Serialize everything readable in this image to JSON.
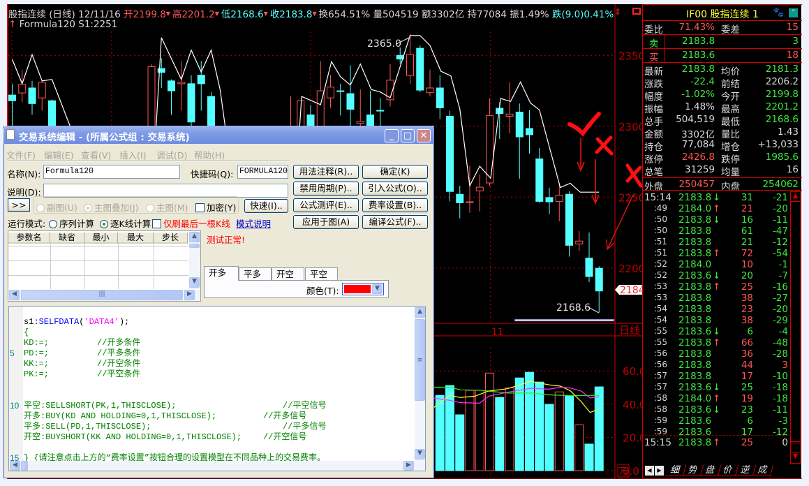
{
  "header": {
    "line1": [
      {
        "t": "股指连续 (日线) 12/11/16 ",
        "c": "w"
      },
      {
        "t": "开2199.8",
        "c": "r",
        "arrow": true
      },
      {
        "t": "高2201.2",
        "c": "r",
        "arrow": true
      },
      {
        "t": "低2168.6",
        "c": "c",
        "arrow": true
      },
      {
        "t": "收2183.8",
        "c": "c",
        "arrow": true
      },
      {
        "t": "换654.51% 量504519 额3302亿 持77084 振1.49% ",
        "c": "w"
      },
      {
        "t": "跌(9.0)0.41%",
        "c": "c"
      }
    ],
    "formula_arrow": "↑",
    "formula": "Formula120 S1:2251"
  },
  "chart_data": {
    "type": "candlestick",
    "price_axis": {
      "ticks": [
        "2350",
        "2300",
        "2250",
        "2200"
      ],
      "values": [
        2350,
        2300,
        2250,
        2200
      ]
    },
    "candles_note": "[bar_index, open, high, low, close]",
    "candles": [
      [
        0,
        2322,
        2330,
        2295,
        2318
      ],
      [
        1,
        2323.5,
        2340,
        2317,
        2329.6
      ],
      [
        2,
        2327,
        2332,
        2308,
        2316
      ],
      [
        3,
        2320,
        2332,
        2311,
        2331
      ],
      [
        4,
        2318,
        2319,
        2285,
        2290
      ],
      [
        14,
        2280,
        2344,
        2275,
        2342
      ],
      [
        15,
        2340.7,
        2348,
        2327,
        2338
      ],
      [
        16,
        2332,
        2333,
        2308,
        2325
      ],
      [
        17,
        2330,
        2346,
        2311,
        2331
      ],
      [
        18,
        2330,
        2336,
        2295,
        2303
      ],
      [
        19,
        2336,
        2346,
        2311,
        2330
      ],
      [
        20,
        2321,
        2324,
        2285,
        2290
      ],
      [
        28,
        2290,
        2321,
        2285,
        2292
      ],
      [
        29,
        2295,
        2318,
        2290,
        2318
      ],
      [
        30,
        2308,
        2315,
        2290,
        2295
      ],
      [
        31,
        2295,
        2346,
        2290,
        2325
      ],
      [
        32,
        2320,
        2336,
        2313,
        2327.6
      ],
      [
        33,
        2325,
        2330,
        2307.6,
        2324.5
      ],
      [
        34,
        2323,
        2343,
        2300,
        2312
      ],
      [
        35,
        2302,
        2326,
        2295,
        2303.5
      ],
      [
        36,
        2308,
        2325,
        2290,
        2295
      ],
      [
        37,
        2311.2,
        2320,
        2298,
        2311
      ],
      [
        38,
        2318.7,
        2344,
        2314,
        2332.5
      ],
      [
        39,
        2350,
        2355.6,
        2344,
        2347.4
      ],
      [
        40,
        2335.8,
        2365,
        2330,
        2350.7
      ],
      [
        41,
        2355,
        2357,
        2324,
        2325.5
      ],
      [
        42,
        2323.7,
        2340,
        2321,
        2327
      ],
      [
        43,
        2327,
        2336,
        2305,
        2313
      ],
      [
        44,
        2307,
        2311,
        2247,
        2254
      ],
      [
        45,
        2252,
        2258,
        2235,
        2246
      ],
      [
        46,
        2246.3,
        2272,
        2239,
        2246.7
      ],
      [
        47,
        2254.4,
        2266,
        2240,
        2257
      ],
      [
        48,
        2260,
        2319.6,
        2257.7,
        2307.6
      ],
      [
        49,
        2312.7,
        2317,
        2291,
        2309
      ],
      [
        50,
        2307,
        2331,
        2295,
        2308.6
      ],
      [
        51,
        2310,
        2316,
        2263,
        2292.5
      ],
      [
        52,
        2298.4,
        2311.4,
        2280.7,
        2294
      ],
      [
        53,
        2277,
        2284.6,
        2246,
        2247
      ],
      [
        54,
        2249.7,
        2256.7,
        2238,
        2246.7
      ],
      [
        55,
        2247,
        2260,
        2233,
        2251.3
      ],
      [
        56,
        2252,
        2254,
        2208,
        2216
      ],
      [
        57,
        2217,
        2226,
        2212,
        2219
      ],
      [
        58,
        2207,
        2225,
        2190,
        2194
      ],
      [
        59,
        2199.8,
        2201.2,
        2168.6,
        2183.8
      ]
    ],
    "signal_line_segments": [
      [
        [
          0,
          2347.2
        ],
        [
          1,
          2330
        ],
        [
          2,
          2350.5
        ],
        [
          3,
          2332
        ],
        [
          4,
          2333
        ],
        [
          5.8,
          2300.4
        ],
        [
          7,
          2270
        ]
      ],
      [
        [
          14.3,
          2280
        ],
        [
          15,
          2362.5
        ],
        [
          17,
          2333
        ],
        [
          18,
          2353.7
        ],
        [
          19,
          2338.2
        ],
        [
          20,
          2353.7
        ],
        [
          20.9,
          2325.9
        ],
        [
          21.4,
          2300.4
        ],
        [
          22,
          2280
        ]
      ],
      [
        [
          28.9,
          2300
        ],
        [
          29.1,
          2321
        ],
        [
          31,
          2315.2
        ],
        [
          32.1,
          2345.6
        ],
        [
          33,
          2334.9
        ],
        [
          34,
          2329.1
        ],
        [
          35,
          2343.9
        ],
        [
          36.1,
          2325.9
        ],
        [
          37,
          2324.2
        ],
        [
          38,
          2320.1
        ],
        [
          40,
          2364
        ],
        [
          41,
          2364
        ],
        [
          42,
          2357
        ],
        [
          43.1,
          2338.8
        ],
        [
          44.1,
          2335.5
        ],
        [
          45,
          2312.2
        ],
        [
          46,
          2258
        ],
        [
          47,
          2271.8
        ],
        [
          48.1,
          2263.3
        ],
        [
          49.1,
          2319.6
        ],
        [
          50.1,
          2317.5
        ],
        [
          51.1,
          2331.2
        ],
        [
          52.1,
          2316.4
        ],
        [
          53,
          2311.5
        ],
        [
          55.1,
          2256.8
        ],
        [
          56.1,
          2259.8
        ],
        [
          57.1,
          2253.5
        ],
        [
          59,
          2253.5
        ]
      ]
    ],
    "high_label": "2365.0",
    "low_label": "2168.6",
    "last_price_tag": "2184",
    "date_label": "11",
    "period_label": "日线",
    "volume": {
      "unit": "万",
      "ticks": [
        "60.0",
        "40.0",
        "20.0",
        "0.0"
      ],
      "tick_values": [
        60,
        40,
        20,
        0
      ],
      "bars": [
        [
          43,
          45.3
        ],
        [
          44,
          51.2
        ],
        [
          45,
          33.6
        ],
        [
          46,
          48.3
        ],
        [
          47,
          48.3
        ],
        [
          48,
          58.7
        ],
        [
          49,
          44.1
        ],
        [
          50,
          49.8
        ],
        [
          51,
          55.8
        ],
        [
          52,
          59.2
        ],
        [
          53,
          53.3
        ],
        [
          54,
          39.9
        ],
        [
          55,
          47.4
        ],
        [
          56,
          45.1
        ],
        [
          57,
          27.6
        ],
        [
          58,
          16.0
        ],
        [
          59,
          50.4
        ]
      ],
      "ma_yellow": [
        [
          42.35,
          37.8
        ],
        [
          44,
          45.3
        ],
        [
          45.05,
          44
        ],
        [
          46.5,
          44.8
        ],
        [
          47.9,
          47.9
        ],
        [
          49.8,
          49.3
        ],
        [
          52.1,
          53.7
        ],
        [
          54,
          51.6
        ],
        [
          55.1,
          50.9
        ],
        [
          56.1,
          48.1
        ],
        [
          57.2,
          41.6
        ],
        [
          58.1,
          35
        ],
        [
          59,
          37.1
        ]
      ],
      "ma_magenta": [
        [
          42.35,
          43.7
        ],
        [
          44,
          42.3
        ],
        [
          45.05,
          40.9
        ],
        [
          47,
          40.6
        ],
        [
          47.9,
          44.8
        ],
        [
          49.8,
          47.2
        ],
        [
          52.1,
          49.5
        ],
        [
          54,
          49.0
        ],
        [
          55.1,
          50.2
        ],
        [
          56.1,
          49.7
        ],
        [
          57.2,
          47.9
        ],
        [
          58.1,
          43.7
        ],
        [
          59,
          44.4
        ]
      ],
      "ma_green": [
        [
          42.35,
          50.2
        ],
        [
          44,
          50.2
        ],
        [
          45.05,
          48.6
        ],
        [
          47,
          48.4
        ],
        [
          47.9,
          47.9
        ],
        [
          49.8,
          46.7
        ],
        [
          52.1,
          46.7
        ],
        [
          54,
          45.6
        ],
        [
          56.1,
          45.1
        ],
        [
          59,
          45.3
        ]
      ]
    },
    "colors": {
      "up": "#ff5454",
      "down": "#54ffff",
      "line": "#ffffff",
      "grid": "#c00000"
    }
  },
  "quote": {
    "title": "IF00  股指连续  1",
    "weibi": {
      "l1": "委比",
      "v1": "71.43%",
      "l2": "委差",
      "v2": "15"
    },
    "sell": {
      "label": "卖",
      "price": "2183.8",
      "vol": "3"
    },
    "buy": {
      "label": "买",
      "price": "2183.6",
      "vol": "18"
    },
    "rows": [
      {
        "l1": "最新",
        "v1": "2183.8",
        "c1": "g",
        "l2": "均价",
        "v2": "2181.3",
        "c2": "g"
      },
      {
        "l1": "涨跌",
        "v1": "-22.4",
        "c1": "g",
        "l2": "前结",
        "v2": "2206.2",
        "c2": "w"
      },
      {
        "l1": "幅度",
        "v1": "-1.02%",
        "c1": "g",
        "l2": "今开",
        "v2": "2199.8",
        "c2": "g"
      },
      {
        "l1": "振幅",
        "v1": "1.48%",
        "c1": "w",
        "l2": "最高",
        "v2": "2201.2",
        "c2": "g"
      },
      {
        "l1": "总手",
        "v1": "504,519",
        "c1": "w",
        "l2": "最低",
        "v2": "2168.6",
        "c2": "g"
      },
      {
        "l1": "金额",
        "v1": "3302亿",
        "c1": "w",
        "l2": "量比",
        "v2": "1.43",
        "c2": "w"
      },
      {
        "l1": "持仓",
        "v1": "77,084",
        "c1": "w",
        "l2": "增仓",
        "v2": "+13,033",
        "c2": "w"
      },
      {
        "l1": "涨停",
        "v1": "2426.8",
        "c1": "r",
        "l2": "跌停",
        "v2": "1985.6",
        "c2": "g"
      },
      {
        "l1": "总笔",
        "v1": "31259",
        "c1": "w",
        "l2": "均量",
        "v2": "16",
        "c2": "w"
      }
    ],
    "outer": {
      "l1": "外盘",
      "v1": "250457",
      "l2": "内盘",
      "v2": "254062"
    },
    "ticks": [
      [
        "15:14",
        "2183.8",
        "↓",
        "31",
        "-21",
        "g",
        "g"
      ],
      [
        ":49",
        "2184.0",
        "↑",
        "21",
        "-20",
        "r",
        "g"
      ],
      [
        ":50",
        "2183.8",
        "↓",
        "16",
        "-11",
        "g",
        "g"
      ],
      [
        ":50",
        "2183.8",
        "",
        "61",
        "-47",
        "g",
        "g"
      ],
      [
        ":51",
        "2183.8",
        "",
        "21",
        "-12",
        "g",
        "g"
      ],
      [
        ":51",
        "2183.8",
        "↑",
        "72",
        "-54",
        "r",
        "g"
      ],
      [
        ":52",
        "2184.0",
        "",
        "10",
        "-1",
        "r",
        "g"
      ],
      [
        ":52",
        "2183.6",
        "↓",
        "20",
        "-7",
        "g",
        "g"
      ],
      [
        ":53",
        "2183.8",
        "↑",
        "25",
        "-16",
        "r",
        "g"
      ],
      [
        ":53",
        "2183.8",
        "",
        "38",
        "-27",
        "r",
        "g"
      ],
      [
        ":54",
        "2183.8",
        "",
        "23",
        "-20",
        "r",
        "g"
      ],
      [
        ":54",
        "2183.8",
        "",
        "38",
        "-29",
        "r",
        "g"
      ],
      [
        ":55",
        "2183.6",
        "↓",
        "6",
        "-4",
        "g",
        "g"
      ],
      [
        ":55",
        "2183.8",
        "↑",
        "66",
        "-48",
        "r",
        "g"
      ],
      [
        ":56",
        "2183.8",
        "",
        "36",
        "-28",
        "r",
        "g"
      ],
      [
        ":56",
        "2183.8",
        "",
        "44",
        "3",
        "r",
        "r"
      ],
      [
        ":57",
        "2183.8",
        "",
        "17",
        "-10",
        "r",
        "g"
      ],
      [
        ":57",
        "2183.6",
        "↓",
        "25",
        "-18",
        "g",
        "g"
      ],
      [
        ":58",
        "2184.0",
        "↑",
        "19",
        "-18",
        "r",
        "g"
      ],
      [
        ":58",
        "2183.6",
        "↓",
        "23",
        "-11",
        "g",
        "g"
      ],
      [
        ":59",
        "2183.6",
        "",
        "6",
        "-3",
        "g",
        "g"
      ],
      [
        ":59",
        "2183.6",
        "",
        "17",
        "-12",
        "g",
        "g"
      ],
      [
        "15:15",
        "2183.8",
        "↑",
        "25",
        "0",
        "r",
        "w"
      ]
    ],
    "tabs": [
      "细",
      "势",
      "盘",
      "价",
      "逆",
      "成"
    ]
  },
  "dialog": {
    "title": "交易系统编辑 - (所属公式组 : 交易系统)",
    "menu": [
      "文件(F)",
      "编辑(E)",
      "查看(V)",
      "插入(I)",
      "调试(D)",
      "帮助(H)"
    ],
    "name_label": "名称(N):",
    "name_value": "Formula120",
    "shortcut_label": "快捷码(Q):",
    "shortcut_value": "FORMULA120",
    "desc_label": "说明(D):",
    "desc_value": "",
    "expand_label": ">>",
    "radio_sub": "副图(U)",
    "radio_overlay": "主图叠加(J)",
    "radio_main": "主图(M)",
    "encrypt_label": "加密(Y)",
    "quick_button": "快速(I)..",
    "mode_label": "运行模式:",
    "mode_series": "序列计算",
    "mode_bar": "逐K线计算",
    "last_bar_only": "仅刷最后一根K线",
    "mode_help": "模式说明",
    "buttons": [
      "用法注释(R)..",
      "确定(K)",
      "禁用周期(P)..",
      "引入公式(O)..",
      "公式测评(E)..",
      "费率设置(B)..",
      "应用于图(A)",
      "编译公式(F).."
    ],
    "param_headers": [
      "参数名",
      "缺省",
      "最小",
      "最大",
      "步长"
    ],
    "status": "测试正常!",
    "signal_tabs": [
      "开多",
      "平多",
      "开空",
      "平空"
    ],
    "color_label": "颜色(T):",
    "color_value": "#ff0000",
    "code_lines": [
      {
        "n": "",
        "parts": [
          [
            "s1:",
            "#000"
          ],
          [
            "SELFDATA",
            "#0000ff"
          ],
          [
            "(",
            "#000"
          ],
          [
            "'DATA4'",
            "#ff00ff"
          ],
          [
            ");",
            "#000"
          ]
        ],
        "cm": ""
      },
      {
        "n": "",
        "parts": [
          [
            "{",
            "#008000"
          ]
        ],
        "cm": ""
      },
      {
        "n": "",
        "parts": [
          [
            "KD:=;",
            "#008000"
          ]
        ],
        "cm": "//开多条件",
        "cx": "a"
      },
      {
        "n": "5",
        "parts": [
          [
            "PD:=;",
            "#008000"
          ]
        ],
        "cm": "//平多条件",
        "cx": "a"
      },
      {
        "n": "",
        "parts": [
          [
            "KK:=;",
            "#008000"
          ]
        ],
        "cm": "//开空条件",
        "cx": "a"
      },
      {
        "n": "",
        "parts": [
          [
            "PK:=;",
            "#008000"
          ]
        ],
        "cm": "//平空条件",
        "cx": "a"
      },
      {
        "n": "",
        "parts": [],
        "cm": ""
      },
      {
        "n": "",
        "parts": [],
        "cm": ""
      },
      {
        "n": "10",
        "parts": [
          [
            "平空:SELLSHORT(PK,1,THISCLOSE);",
            "#008000"
          ]
        ],
        "cm": "//平空信号",
        "cx": "c"
      },
      {
        "n": "",
        "parts": [
          [
            "开多:BUY(KD AND HOLDING=0,1,THISCLOSE);",
            "#008000"
          ]
        ],
        "cm": "//开多信号",
        "cx": "b"
      },
      {
        "n": "",
        "parts": [
          [
            "平多:SELL(PD,1,THISCLOSE);",
            "#008000"
          ]
        ],
        "cm": "//平多信号",
        "cx": "c"
      },
      {
        "n": "",
        "parts": [
          [
            "开空:BUYSHORT(KK AND HOLDING=0,1,THISCLOSE);",
            "#008000"
          ]
        ],
        "cm": "//开空信号",
        "cx": "b"
      },
      {
        "n": "",
        "parts": [],
        "cm": ""
      },
      {
        "n": "15",
        "parts": [
          [
            "} {请注意点击上方的“费率设置”按钮合理的设置模型在不同品种上的交易费率。",
            "#008000"
          ]
        ],
        "cm": ""
      }
    ]
  }
}
